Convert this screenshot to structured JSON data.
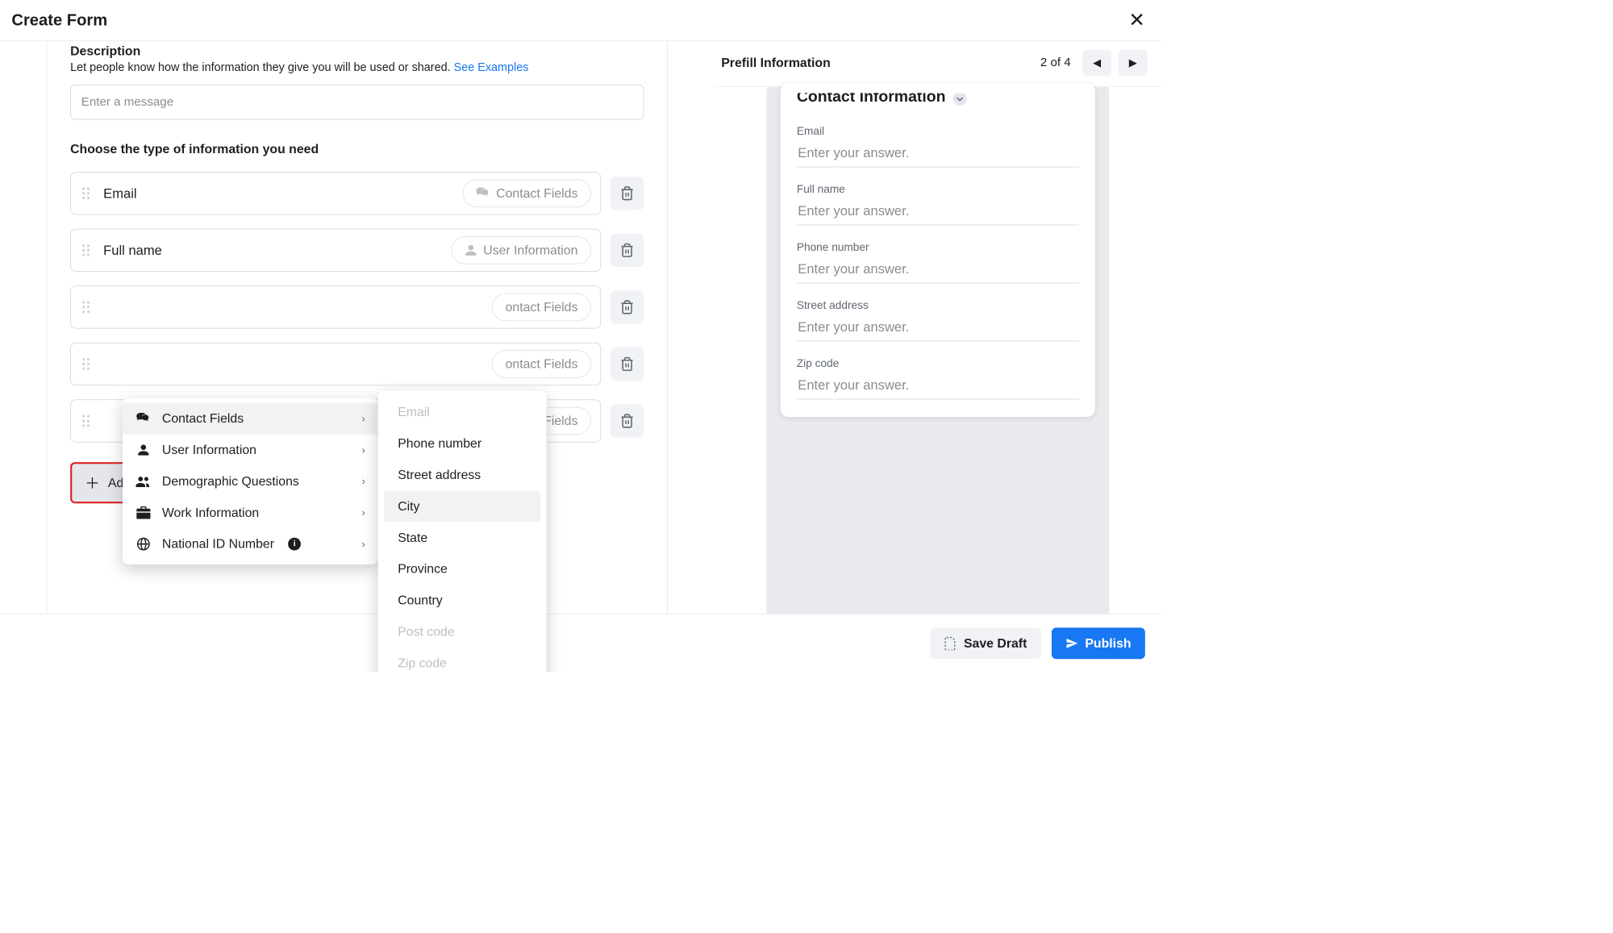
{
  "header": {
    "title": "Create Form"
  },
  "description": {
    "heading": "Description",
    "sub_pre": "Let people know how the information they give you will be used or shared. ",
    "link": "See Examples",
    "placeholder": "Enter a message"
  },
  "choose_label": "Choose the type of information you need",
  "fields": [
    {
      "name": "Email",
      "tag": "Contact Fields",
      "tag_type": "contact"
    },
    {
      "name": "Full name",
      "tag": "User Information",
      "tag_type": "user"
    },
    {
      "name": "",
      "tag": "ontact Fields",
      "tag_type": "contact"
    },
    {
      "name": "",
      "tag": "ontact Fields",
      "tag_type": "contact"
    },
    {
      "name": "",
      "tag": "ontact Fields",
      "tag_type": "contact"
    }
  ],
  "add_category_label": "Add Category",
  "categories": {
    "items": [
      {
        "label": "Contact Fields",
        "icon": "chat"
      },
      {
        "label": "User Information",
        "icon": "person"
      },
      {
        "label": "Demographic Questions",
        "icon": "group"
      },
      {
        "label": "Work Information",
        "icon": "briefcase"
      },
      {
        "label": "National ID Number",
        "icon": "globe",
        "info": true
      }
    ],
    "contact_fields": [
      {
        "label": "Email",
        "disabled": true
      },
      {
        "label": "Phone number",
        "disabled": false
      },
      {
        "label": "Street address",
        "disabled": false
      },
      {
        "label": "City",
        "disabled": false,
        "highlight": true
      },
      {
        "label": "State",
        "disabled": false
      },
      {
        "label": "Province",
        "disabled": false
      },
      {
        "label": "Country",
        "disabled": false
      },
      {
        "label": "Post code",
        "disabled": true
      },
      {
        "label": "Zip code",
        "disabled": true
      }
    ]
  },
  "preview": {
    "title": "Prefill Information",
    "step": "2 of 4",
    "card_title": "Contact Information",
    "answer_placeholder": "Enter your answer.",
    "fields": [
      "Email",
      "Full name",
      "Phone number",
      "Street address",
      "Zip code"
    ]
  },
  "footer": {
    "save_draft": "Save Draft",
    "publish": "Publish"
  }
}
